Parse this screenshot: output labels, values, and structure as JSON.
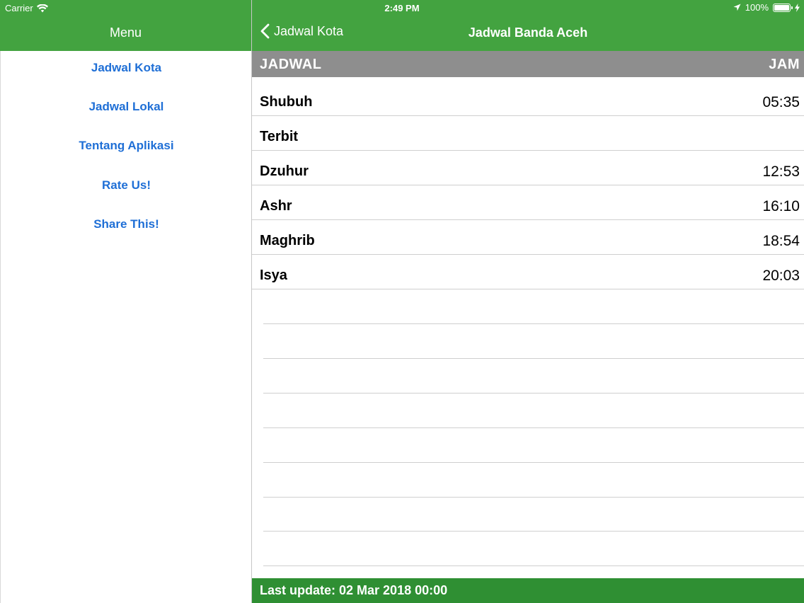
{
  "status_bar": {
    "carrier": "Carrier",
    "time": "2:49 PM",
    "battery": "100%",
    "icons": [
      "wifi-icon",
      "location-arrow-icon",
      "battery-icon",
      "charging-bolt-icon"
    ]
  },
  "menu": {
    "title": "Menu",
    "items": [
      {
        "label": "Jadwal Kota"
      },
      {
        "label": "Jadwal Lokal"
      },
      {
        "label": "Tentang Aplikasi"
      },
      {
        "label": "Rate Us!"
      },
      {
        "label": "Share This!"
      }
    ]
  },
  "detail": {
    "back_label": "Jadwal Kota",
    "title": "Jadwal Banda Aceh",
    "header": {
      "left": "JADWAL",
      "right": "JAM"
    },
    "rows": [
      {
        "name": "Shubuh",
        "time": "05:35"
      },
      {
        "name": "Terbit",
        "time": ""
      },
      {
        "name": "Dzuhur",
        "time": "12:53"
      },
      {
        "name": "Ashr",
        "time": "16:10"
      },
      {
        "name": "Maghrib",
        "time": "18:54"
      },
      {
        "name": "Isya",
        "time": "20:03"
      }
    ],
    "footer": "Last update: 02 Mar 2018 00:00"
  },
  "colors": {
    "nav_green": "#43a340",
    "footer_green": "#2f8f33",
    "header_gray": "#8e8e8e",
    "menu_link": "#1f6fd6"
  }
}
